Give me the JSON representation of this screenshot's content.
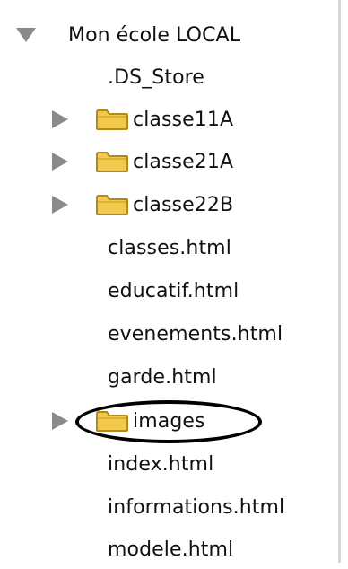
{
  "tree": {
    "root": {
      "label": "Mon école LOCAL",
      "expanded": true
    },
    "items": [
      {
        "type": "file",
        "label": ".DS_Store"
      },
      {
        "type": "folder",
        "label": "classe11A",
        "expanded": false
      },
      {
        "type": "folder",
        "label": "classe21A",
        "expanded": false
      },
      {
        "type": "folder",
        "label": "classe22B",
        "expanded": false
      },
      {
        "type": "file",
        "label": "classes.html"
      },
      {
        "type": "file",
        "label": "educatif.html"
      },
      {
        "type": "file",
        "label": "evenements.html"
      },
      {
        "type": "file",
        "label": "garde.html"
      },
      {
        "type": "folder",
        "label": "images",
        "expanded": false,
        "highlighted": true
      },
      {
        "type": "file",
        "label": "index.html"
      },
      {
        "type": "file",
        "label": "informations.html"
      },
      {
        "type": "file",
        "label": "modele.html"
      }
    ]
  },
  "colors": {
    "disclosure": "#8a8a8a",
    "folder_fill": "#f2c94c",
    "folder_stroke": "#b08a1e",
    "annotation": "#000000"
  },
  "icons": {
    "expand": "triangle-down-icon",
    "collapse": "triangle-right-icon",
    "folder": "folder-icon"
  }
}
